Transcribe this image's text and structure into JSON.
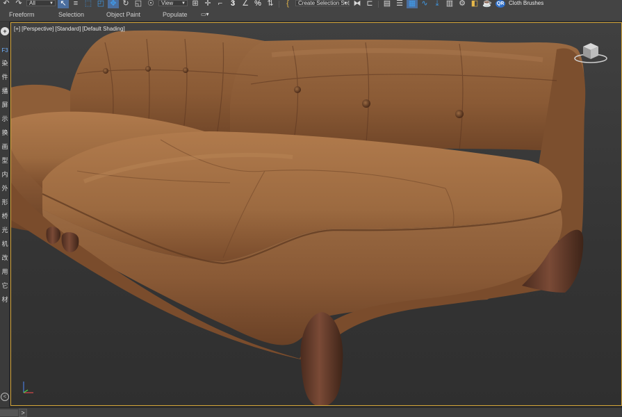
{
  "toolbar": {
    "selection_filter": "All",
    "reference_coord": "View",
    "snap_value": "3",
    "percent_snap": "%",
    "named_selection_placeholder": "Create Selection Set",
    "qr_badge": "QR",
    "cloth_brushes": "Cloth Brushes",
    "icons": [
      "undo-icon",
      "redo-icon",
      "select-object-icon",
      "select-by-name-icon",
      "rect-region-icon",
      "window-crossing-icon",
      "select-move-icon",
      "select-rotate-icon",
      "select-scale-icon",
      "select-place-icon",
      "move-3d-icon",
      "snap-toggle-icon",
      "angle-snap-icon",
      "percent-snap-icon",
      "spinner-snap-icon",
      "edit-named-sets-icon",
      "mirror-icon",
      "align-icon",
      "layer-explorer-icon",
      "scene-explorer-icon",
      "toggle-ribbon-icon",
      "curve-editor-icon",
      "schematic-view-icon",
      "material-editor-icon",
      "render-setup-icon",
      "render-frame-icon",
      "render-icon"
    ]
  },
  "ribbon": {
    "tabs": [
      "Freeform",
      "Selection",
      "Object Paint",
      "Populate"
    ],
    "toggle_glyph": "▭▾"
  },
  "left_panel": {
    "top_glyph": "+",
    "f3": "F3",
    "items": [
      "染",
      "件",
      "播",
      "屏",
      "示",
      "换",
      "画",
      "型",
      "内",
      "外",
      "形",
      "桥",
      "光",
      "机",
      "改",
      "用",
      "它",
      "材"
    ],
    "bottom_glyph": "<"
  },
  "viewport": {
    "label_plus": "[+]",
    "label_view": "[Perspective]",
    "label_mode": "[Standard]",
    "label_shading": "[Default Shading]",
    "scene": "brown-leather-tufted-sofa",
    "colors": {
      "leather_light": "#a8744a",
      "leather_mid": "#8a5a35",
      "leather_dark": "#5a3520",
      "leg": "#6b4030",
      "bg": "#3a3a3a",
      "border_active": "#d5a63a"
    }
  },
  "timeline": {
    "next_glyph": ">"
  }
}
